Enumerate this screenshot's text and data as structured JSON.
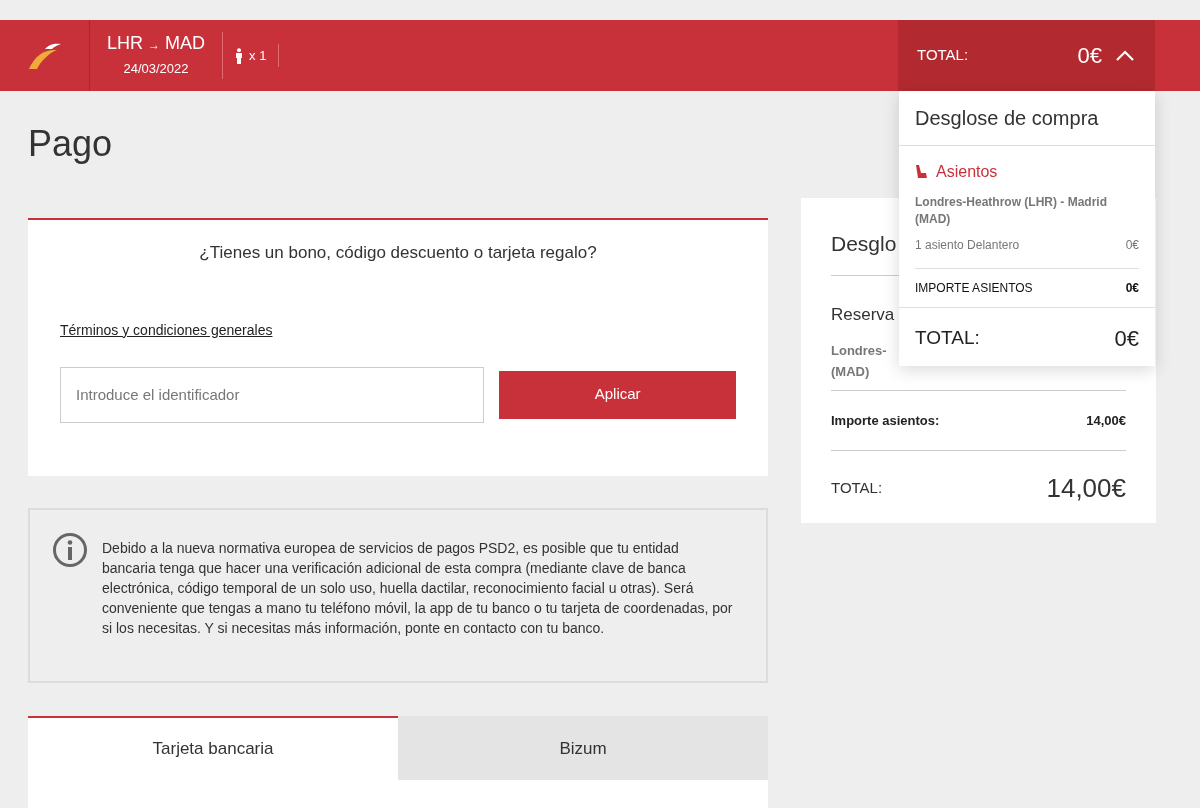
{
  "header": {
    "origin": "LHR",
    "arrow": "→",
    "destination": "MAD",
    "date": "24/03/2022",
    "passengers": "x 1",
    "total_label": "TOTAL:",
    "total_value": "0€",
    "expanded": true
  },
  "page_title": "Pago",
  "voucher": {
    "question": "¿Tienes un bono, código descuento o tarjeta regalo?",
    "terms_link": "Términos y condiciones generales",
    "placeholder": "Introduce el identificador",
    "apply_button": "Aplicar"
  },
  "notice": "Debido a la nueva normativa europea de servicios de pagos PSD2, es posible que tu entidad bancaria tenga que hacer una verificación adicional de esta compra (mediante clave de banca electrónica, código temporal de un solo uso, huella dactilar, reconocimiento facial u otras). Será conveniente que tengas a mano tu teléfono móvil, la app de tu banco o tu tarjeta de coordenadas, por si los necesitas. Y si necesitas más información, ponte en contacto con tu banco.",
  "payment_tabs": [
    {
      "label": "Tarjeta bancaria",
      "selected": true
    },
    {
      "label": "Bizum",
      "selected": false
    }
  ],
  "summary_card": {
    "title": "Desglo",
    "section": "Reserva",
    "route_line_1": "Londres-",
    "route_line_2": "(MAD)",
    "seats_label": "Importe asientos:",
    "seats_value": "14,00€",
    "total_label": "TOTAL:",
    "total_value": "14,00€"
  },
  "dropdown": {
    "title": "Desglose de compra",
    "category": "Asientos",
    "route": "Londres-Heathrow (LHR) - Madrid (MAD)",
    "item_label": "1 asiento Delantero",
    "item_value": "0€",
    "subtotal_label": "IMPORTE ASIENTOS",
    "subtotal_value": "0€",
    "total_label": "TOTAL:",
    "total_value": "0€"
  }
}
